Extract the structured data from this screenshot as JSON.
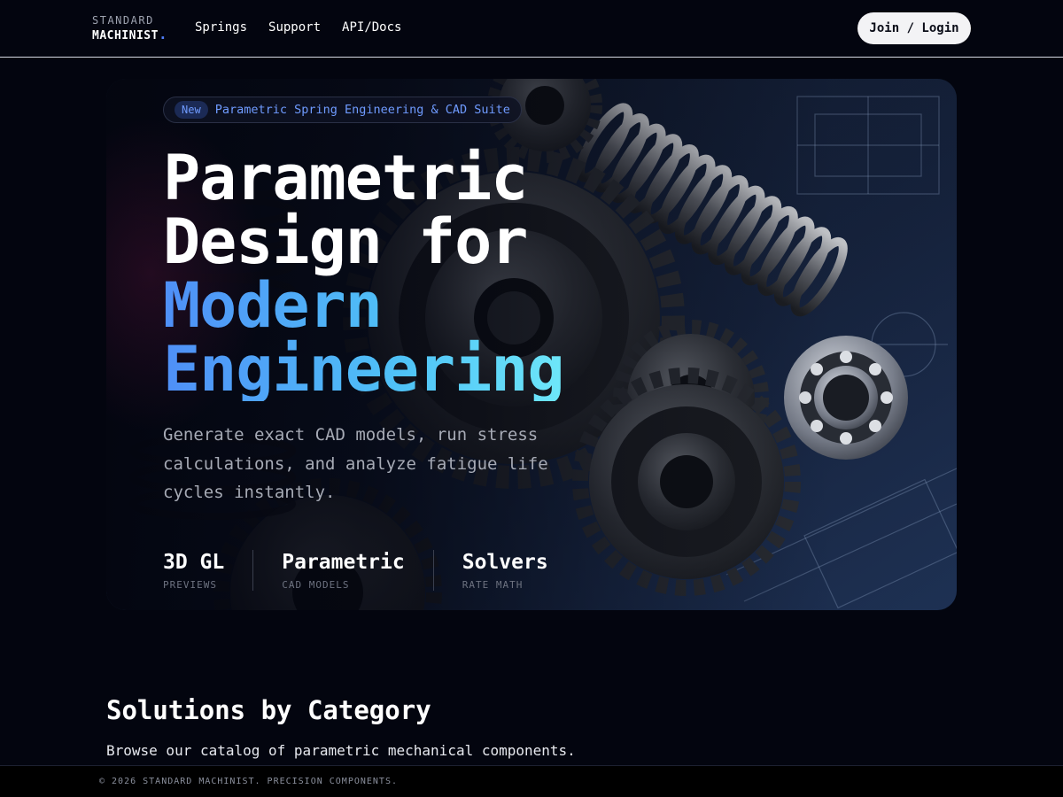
{
  "nav": {
    "logo_top": "STANDARD",
    "logo_bottom": "MACHINIST",
    "logo_dot": ".",
    "links": [
      "Springs",
      "Support",
      "API/Docs"
    ],
    "cta": "Join / Login"
  },
  "hero": {
    "badge": "New",
    "badge_text": "Parametric Spring Engineering & CAD Suite",
    "headline_line1": "Parametric",
    "headline_line2": "Design for",
    "headline_line3": "Modern",
    "headline_line4": "Engineering",
    "description": "Generate exact CAD models, run stress calculations, and analyze fatigue life cycles instantly.",
    "stats": [
      {
        "value": "3D GL",
        "label": "PREVIEWS"
      },
      {
        "value": "Parametric",
        "label": "CAD MODELS"
      },
      {
        "value": "Solvers",
        "label": "RATE MATH"
      }
    ]
  },
  "solutions": {
    "title": "Solutions by Category",
    "subtitle": "Browse our catalog of parametric mechanical components."
  },
  "footer": {
    "text": "© 2026 STANDARD MACHINIST. PRECISION COMPONENTS."
  },
  "colors": {
    "background": "#03050f",
    "accent_blue": "#4f8ff7",
    "accent_cyan": "#4fc3f7",
    "button_bg": "#f3f3f5"
  }
}
